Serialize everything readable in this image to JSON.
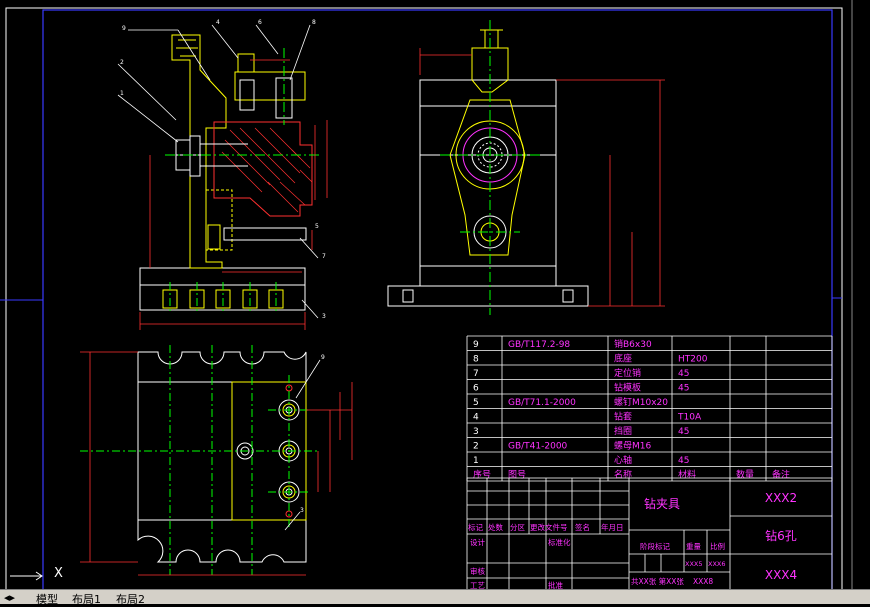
{
  "tabs": [
    "模型",
    "布局1",
    "布局2"
  ],
  "ucs_axis_label": "X",
  "callouts": {
    "front": [
      "9",
      "4",
      "6",
      "8",
      "2",
      "1",
      "5",
      "7",
      "3"
    ],
    "plan": [
      "9",
      "3"
    ]
  },
  "parts_table": {
    "header": [
      "序号",
      "图号",
      "名称",
      "材料",
      "数量",
      "备注"
    ],
    "rows": [
      {
        "no": "9",
        "code": "GB/T117.2-98",
        "name": "销B6x30",
        "material": "",
        "qty": "",
        "note": ""
      },
      {
        "no": "8",
        "code": "",
        "name": "底座",
        "material": "HT200",
        "qty": "",
        "note": ""
      },
      {
        "no": "7",
        "code": "",
        "name": "定位销",
        "material": "45",
        "qty": "",
        "note": ""
      },
      {
        "no": "6",
        "code": "",
        "name": "钻模板",
        "material": "45",
        "qty": "",
        "note": ""
      },
      {
        "no": "5",
        "code": "GB/T71.1-2000",
        "name": "螺钉M10x20",
        "material": "",
        "qty": "",
        "note": ""
      },
      {
        "no": "4",
        "code": "",
        "name": "钻套",
        "material": "T10A",
        "qty": "",
        "note": ""
      },
      {
        "no": "3",
        "code": "",
        "name": "挡圈",
        "material": "45",
        "qty": "",
        "note": ""
      },
      {
        "no": "2",
        "code": "GB/T41-2000",
        "name": "螺母M16",
        "material": "",
        "qty": "",
        "note": ""
      },
      {
        "no": "1",
        "code": "",
        "name": "心轴",
        "material": "45",
        "qty": "",
        "note": ""
      }
    ]
  },
  "title_block": {
    "title": "钻夹具",
    "drawing_no": "XXX2",
    "subtitle": "钻6孔",
    "company": "XXX4",
    "revision_headers": [
      "标记",
      "处数",
      "分区",
      "更改文件号",
      "签名",
      "年月日"
    ],
    "row_labels": [
      "设计",
      "标准化",
      "审核",
      "工艺",
      "批准"
    ],
    "stage_label": "阶段标记",
    "weight_label": "重量",
    "scale_label": "比例",
    "weight_value": "XXX5",
    "scale_value": "XXX6",
    "sheet_info": "共XX张 第XX张",
    "sheet_code": "XXX8"
  }
}
